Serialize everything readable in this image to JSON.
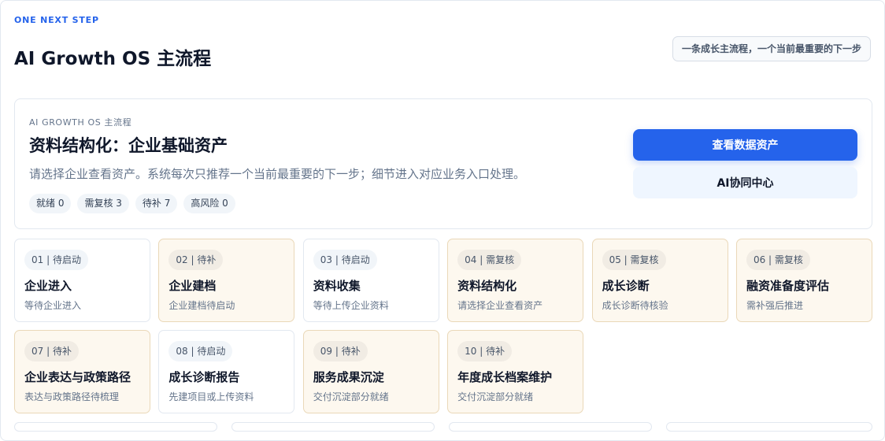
{
  "header": {
    "eyebrow": "ONE NEXT STEP",
    "title": "AI Growth OS 主流程",
    "badge": "一条成长主流程，一个当前最重要的下一步"
  },
  "hero": {
    "eyebrow": "AI GROWTH OS 主流程",
    "title": "资料结构化：企业基础资产",
    "description": "请选择企业查看资产。系统每次只推荐一个当前最重要的下一步；细节进入对应业务入口处理。",
    "chips": [
      "就绪 0",
      "需复核 3",
      "待补 7",
      "高风险 0"
    ],
    "primary_button": "查看数据资产",
    "secondary_button": "AI协同中心"
  },
  "steps": [
    {
      "tag": "01 | 待启动",
      "title": "企业进入",
      "subtitle": "等待企业进入",
      "state": "idle"
    },
    {
      "tag": "02 | 待补",
      "title": "企业建档",
      "subtitle": "企业建档待启动",
      "state": "warn"
    },
    {
      "tag": "03 | 待启动",
      "title": "资料收集",
      "subtitle": "等待上传企业资料",
      "state": "idle"
    },
    {
      "tag": "04 | 需复核",
      "title": "资料结构化",
      "subtitle": "请选择企业查看资产",
      "state": "warn"
    },
    {
      "tag": "05 | 需复核",
      "title": "成长诊断",
      "subtitle": "成长诊断待核验",
      "state": "warn"
    },
    {
      "tag": "06 | 需复核",
      "title": "融资准备度评估",
      "subtitle": "需补强后推进",
      "state": "warn"
    },
    {
      "tag": "07 | 待补",
      "title": "企业表达与政策路径",
      "subtitle": "表达与政策路径待梳理",
      "state": "warn"
    },
    {
      "tag": "08 | 待启动",
      "title": "成长诊断报告",
      "subtitle": "先建项目或上传资料",
      "state": "idle"
    },
    {
      "tag": "09 | 待补",
      "title": "服务成果沉淀",
      "subtitle": "交付沉淀部分就绪",
      "state": "warn"
    },
    {
      "tag": "10 | 待补",
      "title": "年度成长档案维护",
      "subtitle": "交付沉淀部分就绪",
      "state": "warn"
    }
  ],
  "colors": {
    "accent": "#2563eb",
    "warn_bg": "#fdf8ef",
    "warn_border": "#ead8b8"
  }
}
